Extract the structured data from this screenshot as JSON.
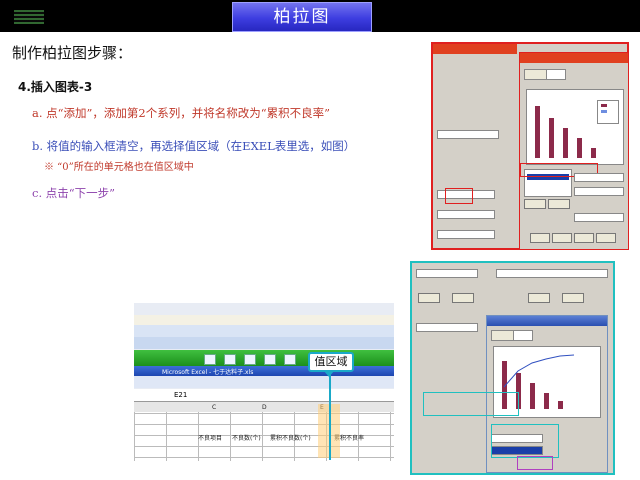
{
  "header": {
    "title": "柏拉图"
  },
  "slide": {
    "heading": "制作柏拉图步骤：",
    "subheading": "4.插入图表-3",
    "steps": {
      "a": "a. 点“添加”，添加第2个系列，并将名称改为“累积不良率”",
      "b": "b. 将值的输入框清空，再选择值区域（在EXEL表里选，如图）",
      "note": "※ “0”所在的单元格也在值区域中",
      "c": "c. 点击“下一步”"
    }
  },
  "excel": {
    "callout": "值区域",
    "window_title": "Microsoft Excel - 七于达料子.xls",
    "cell_ref": "E21",
    "columns": [
      "C",
      "D",
      "E"
    ],
    "header_row": [
      "不良项目",
      "不良数(个)",
      "累积不良数(个)",
      "累积不良率"
    ]
  },
  "colors": {
    "title_bg": "#3d3de0",
    "red_step": "#c0392b",
    "blue_step": "#3a4eb8",
    "purple_step": "#8e44ad",
    "callout_border": "#1aa9c8"
  }
}
